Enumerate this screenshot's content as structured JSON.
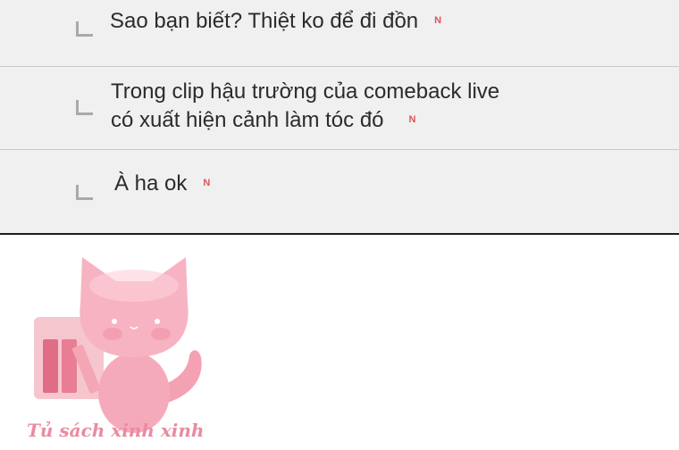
{
  "comments": [
    {
      "lines": [
        "Sao bạn biết? Thiệt ko để đi đồn"
      ],
      "badge": "N"
    },
    {
      "lines": [
        "Trong clip hậu trường của comeback live",
        "có xuất hiện cảnh làm tóc đó"
      ],
      "badge": "N"
    },
    {
      "lines": [
        "À ha ok"
      ],
      "badge": "N"
    }
  ],
  "watermark": {
    "text": "Tủ sách xinh xinh",
    "icon": "pink-cat-bookshelf-logo"
  },
  "colors": {
    "panel_bg": "#f0f0f0",
    "text": "#2b2b2b",
    "badge": "#e2515a",
    "reply_icon": "#a9a9a9",
    "brand_pink": "#e98ba2"
  }
}
